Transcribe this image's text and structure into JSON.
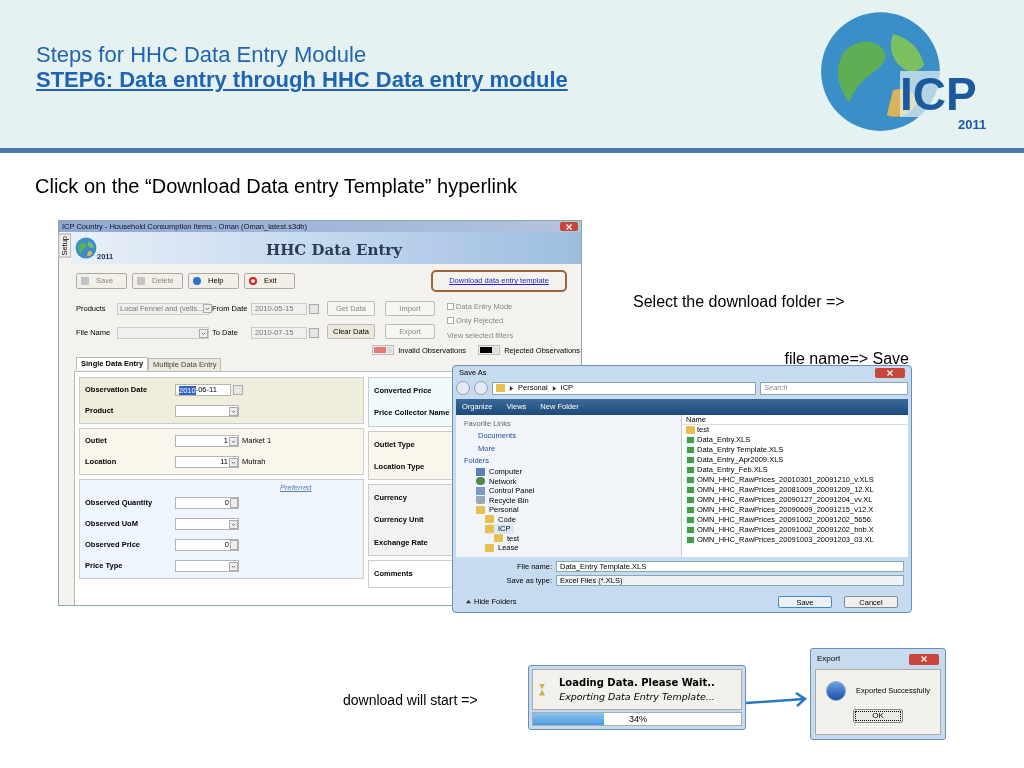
{
  "slide": {
    "title": "Steps for HHC Data Entry Module",
    "subtitle": "STEP6: Data entry through HHC Data entry module",
    "logo": {
      "text": "ICP",
      "year": "2011"
    },
    "instruction": "Click on the “Download Data entry Template” hyperlink",
    "notes": [
      "Select the download folder =>",
      "file name=> Save",
      "download will start =>"
    ]
  },
  "app": {
    "title": "ICP Country - Household Consumption Items - Oman (Oman_latest.s3db)",
    "side_tab": "Setup",
    "logo_year": "2011",
    "header": "HHC Data Entry",
    "toolbar": [
      {
        "label": "Save",
        "disabled": true
      },
      {
        "label": "Delete",
        "disabled": true
      },
      {
        "label": "Help",
        "disabled": false
      },
      {
        "label": "Exit",
        "disabled": false
      }
    ],
    "download_link": "Download data entry template",
    "filters": [
      {
        "label": "Products",
        "kind": "dropdown",
        "value": "Local Fennel and (vells...",
        "disabled": true
      },
      {
        "label": "From Date",
        "kind": "date",
        "value": "2010-05-15",
        "disabled": true
      },
      {
        "label": "File Name",
        "kind": "dropdown",
        "disabled": true
      },
      {
        "label": "To Date",
        "kind": "date",
        "value": "2010-07-15",
        "disabled": true
      }
    ],
    "actions": [
      {
        "label": "Get Data",
        "disabled": true
      },
      {
        "label": "Import",
        "disabled": true
      },
      {
        "label": "Clear Data",
        "disabled": false
      },
      {
        "label": "Export",
        "disabled": true
      }
    ],
    "options": [
      {
        "label": "Data Entry Mode",
        "checked": false,
        "disabled": true
      },
      {
        "label": "Only Rejected",
        "checked": false,
        "disabled": true
      }
    ],
    "filters_link": "View selected filters",
    "legend": [
      {
        "label": "Invalid Observations",
        "color": "#e87878"
      },
      {
        "label": "Rejected Observations",
        "color": "#000000"
      }
    ],
    "tabs": [
      {
        "label": "Single Data Entry",
        "selected": true
      },
      {
        "label": "Multiple Data Entry",
        "selected": false
      }
    ],
    "panels": [
      {
        "fields": [
          {
            "label": "Observation Date",
            "kind": "date",
            "selected_part": "2010",
            "value": "-06-11"
          },
          {
            "label": "Product",
            "kind": "dropdown"
          }
        ]
      },
      {
        "fields": [
          {
            "label": "Outlet",
            "kind": "lookup",
            "value": "1",
            "note": "Market 1"
          },
          {
            "label": "Location",
            "kind": "lookup",
            "value": "11",
            "note": "Mutrah"
          }
        ]
      },
      {
        "link": "Preferred",
        "fields": [
          {
            "label": "Observed Quantity",
            "kind": "spin",
            "value": "0"
          },
          {
            "label": "Observed UoM",
            "kind": "dropdown"
          },
          {
            "label": "Observed Price",
            "kind": "spin",
            "value": "0"
          },
          {
            "label": "Price Type",
            "kind": "dropdown"
          }
        ]
      }
    ],
    "side_panels": [
      {
        "labels": [
          "Converted Price",
          "Price Collector Name"
        ]
      },
      {
        "labels": [
          "Outlet Type",
          "Location Type"
        ]
      },
      {
        "labels": [
          "Currency",
          "Currency Unit",
          "Exchange Rate"
        ]
      },
      {
        "labels": [
          "Comments"
        ]
      }
    ]
  },
  "save_dialog": {
    "title": "Save As",
    "path": [
      "Personal",
      "ICP"
    ],
    "search_placeholder": "Search",
    "toolbar": [
      "Organize",
      "Views",
      "New Folder"
    ],
    "favorites_header": "Favorite Links",
    "favorites": [
      "Documents"
    ],
    "more": "More",
    "folders_header": "Folders",
    "folders": [
      {
        "name": "Computer",
        "kind": "computer",
        "selected": false
      },
      {
        "name": "Network",
        "kind": "network",
        "selected": false
      },
      {
        "name": "Control Panel",
        "kind": "panel",
        "selected": false
      },
      {
        "name": "Recycle Bin",
        "kind": "bin",
        "selected": false
      },
      {
        "name": "Personal",
        "kind": "folder",
        "selected": false,
        "children": [
          {
            "name": "Code",
            "kind": "folder",
            "selected": false
          },
          {
            "name": "ICP",
            "kind": "folder",
            "selected": true,
            "children": [
              {
                "name": "test",
                "kind": "folder",
                "selected": false
              }
            ]
          },
          {
            "name": "Lease",
            "kind": "folder",
            "selected": false
          }
        ]
      }
    ],
    "column": "Name",
    "files": [
      {
        "name": "test",
        "kind": "folder"
      },
      {
        "name": "Data_Entry.XLS",
        "kind": "xls"
      },
      {
        "name": "Data_Entry Template.XLS",
        "kind": "xls"
      },
      {
        "name": "Data_Entry_Apr2009.XLS",
        "kind": "xls"
      },
      {
        "name": "Data_Entry_Feb.XLS",
        "kind": "xls"
      },
      {
        "name": "OMN_HHC_RawPrices_20010301_20091210_v.XLS",
        "kind": "xls"
      },
      {
        "name": "OMN_HHC_RawPrices_20081009_20091209_12.XL",
        "kind": "xls"
      },
      {
        "name": "OMN_HHC_RawPrices_20090127_20091204_vv.XL",
        "kind": "xls"
      },
      {
        "name": "OMN_HHC_RawPrices_20090609_20091215_v12.X",
        "kind": "xls"
      },
      {
        "name": "OMN_HHC_RawPrices_20091002_20091202_5656.",
        "kind": "xls"
      },
      {
        "name": "OMN_HHC_RawPrices_20091002_20091202_bnb.X",
        "kind": "xls"
      },
      {
        "name": "OMN_HHC_RawPrices_20091003_20091203_03.XL",
        "kind": "xls"
      }
    ],
    "file_name_label": "File name:",
    "file_name": "Data_Entry Template.XLS",
    "type_label": "Save as type:",
    "type": "Excel Files (*.XLS)",
    "hide_folders": "Hide Folders",
    "buttons": [
      "Save",
      "Cancel"
    ]
  },
  "progress": {
    "title": "Loading Data. Please Wait..",
    "detail": "Exporting Data Entry Template...",
    "level": 0.34,
    "reading": "34%"
  },
  "export_dialog": {
    "title": "Export",
    "message": "Exported Successfully",
    "button": "OK"
  }
}
